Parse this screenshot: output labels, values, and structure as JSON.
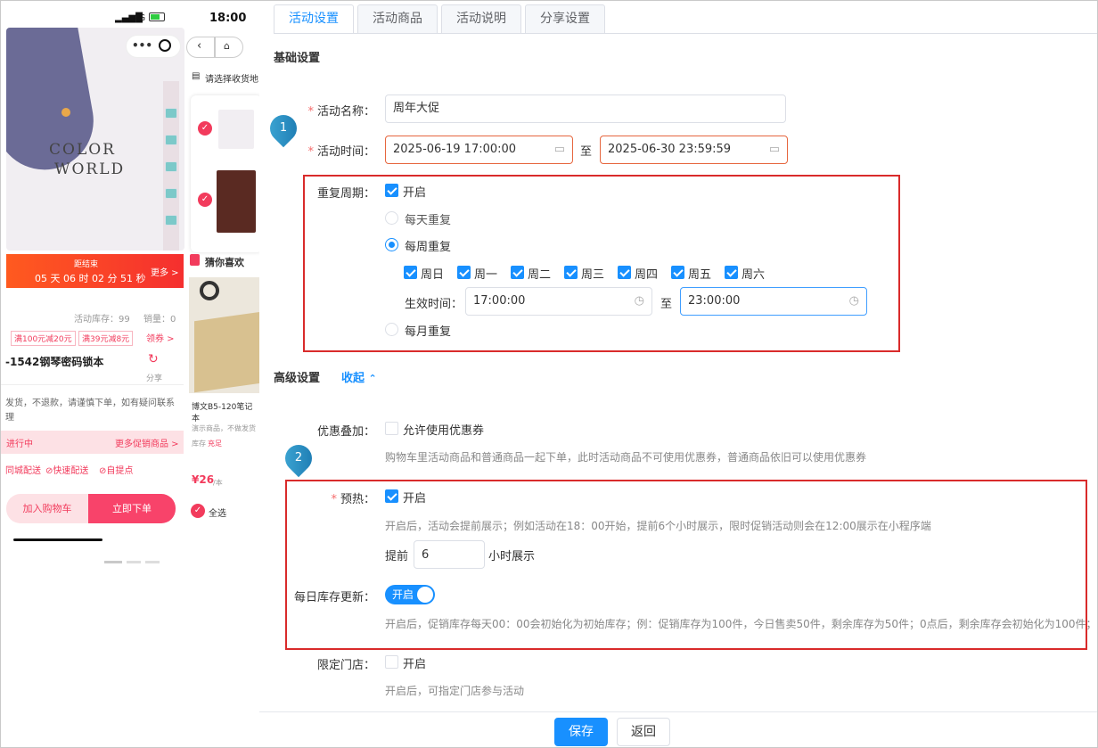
{
  "preview": {
    "status_time": "18:00",
    "network": "4G",
    "book_title_line1": "COLOR",
    "book_title_line2": "WORLD",
    "countdown_label": "距结束",
    "countdown_value": "05 天 06 时 02 分 51 秒",
    "countdown_more": "更多 >",
    "stock_text": "活动库存：99",
    "sales_text": "销量：0",
    "coupon1": "满100元减20元",
    "coupon2": "满39元减8元",
    "coupon_more": "领券 >",
    "product_name": "-1542钢琴密码锁本",
    "share_label": "分享",
    "notice_text": "发货，不退款，请谨慎下单，如有疑问联系",
    "notice_text2": "理",
    "promo_status": "进行中",
    "promo_more": "更多促销商品 >",
    "delivery1": "同城配送",
    "delivery2": "⊘快速配送",
    "delivery3": "⊘自提点",
    "cart_button": "加入购物车",
    "buy_button": "立即下单",
    "side_address": "请选择收货地",
    "side_guess": "猜你喜欢",
    "side_product": "博文B5-120笔记本",
    "side_tip": "演示商品，不做发货",
    "side_stock": "库存",
    "side_stock_status": "充足",
    "side_price": "¥26",
    "side_price_unit": "/本",
    "side_select_all": "全选"
  },
  "tabs": [
    "活动设置",
    "活动商品",
    "活动说明",
    "分享设置"
  ],
  "active_tab": 0,
  "basic": {
    "title": "基础设置",
    "name_label": "活动名称：",
    "name_value": "周年大促",
    "time_label": "活动时间：",
    "start_time": "2025-06-19 17:00:00",
    "end_time": "2025-06-30 23:59:59",
    "to": "至",
    "repeat_label": "重复周期：",
    "repeat_enabled_text": "开启",
    "daily": "每天重复",
    "weekly": "每周重复",
    "monthly": "每月重复",
    "weekdays": [
      "周日",
      "周一",
      "周二",
      "周三",
      "周四",
      "周五",
      "周六"
    ],
    "effective_label": "生效时间：",
    "effective_start": "17:00:00",
    "effective_end": "23:00:00"
  },
  "advanced": {
    "title": "高级设置",
    "collapse": "收起",
    "stack_label": "优惠叠加：",
    "stack_option": "允许使用优惠券",
    "stack_hint": "购物车里活动商品和普通商品一起下单，此时活动商品不可使用优惠券，普通商品依旧可以使用优惠券",
    "preheat_label": "预热：",
    "preheat_option": "开启",
    "preheat_hint": "开启后，活动会提前展示；例如活动在18：00开始，提前6个小时展示，限时促销活动则会在12:00展示在小程序端",
    "advance_prefix": "提前",
    "advance_hours": "6",
    "advance_suffix": "小时展示",
    "daily_stock_label": "每日库存更新：",
    "daily_stock_switch": "开启",
    "daily_stock_hint": "开启后，促销库存每天00：00会初始化为初始库存；例：促销库存为100件，今日售卖50件，剩余库存为50件；0点后，剩余库存会初始化为100件；",
    "store_label": "限定门店：",
    "store_option": "开启",
    "store_hint": "开启后，可指定门店参与活动"
  },
  "markers": [
    "1",
    "2"
  ],
  "footer": {
    "save": "保存",
    "back": "返回"
  },
  "colors": {
    "primary": "#1890ff",
    "highlight": "#d92b2b",
    "price": "#f23b5c"
  }
}
